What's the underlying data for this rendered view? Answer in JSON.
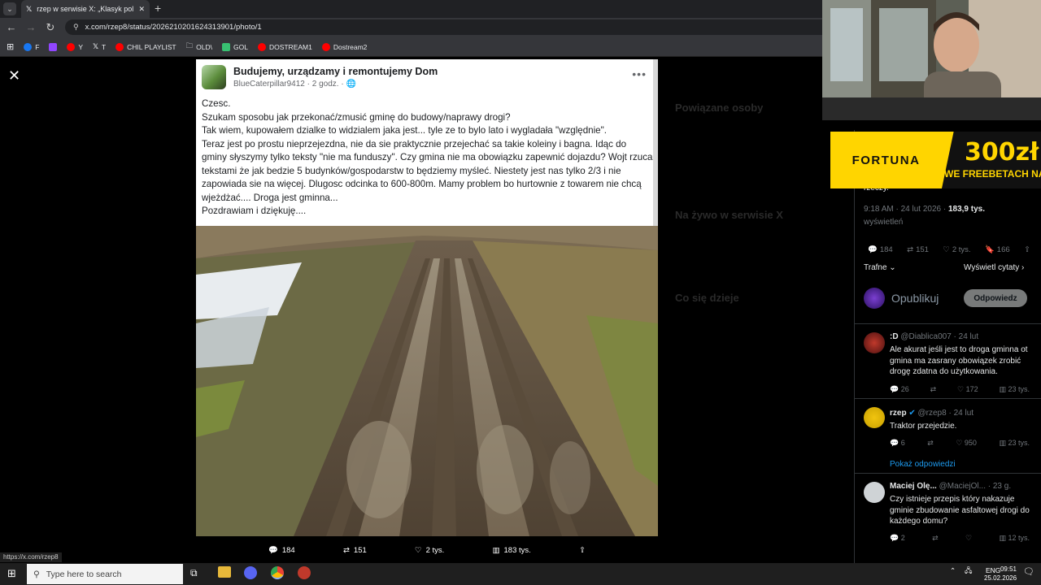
{
  "browser": {
    "tab_title": "rzep w serwisie X: „Klasyk polsk",
    "url": "x.com/rzep8/status/2026210201624313901/photo/1",
    "status_url": "https://x.com/rzep8",
    "bookmarks": [
      {
        "label": "F",
        "color": "#1877f2"
      },
      {
        "label": "",
        "color": "#9146ff"
      },
      {
        "label": "Y",
        "color": "#ff0000"
      },
      {
        "label": "T",
        "color": "#000000"
      },
      {
        "label": "CHIL PLAYLIST",
        "color": "#ff0000"
      },
      {
        "label": "OLD\\",
        "color": "folder"
      },
      {
        "label": "GOL",
        "color": "#38c172"
      },
      {
        "label": "DOSTREAM1",
        "color": "#ff0000"
      },
      {
        "label": "Dostream2",
        "color": "#ff0000"
      }
    ]
  },
  "fb_post": {
    "group": "Budujemy, urządzamy i remontujemy Dom",
    "author": "BlueCaterpillar9412",
    "time": "2 godz.",
    "lines": [
      "Czesc.",
      "Szukam sposobu jak przekonać/zmusić gminę do budowy/naprawy drogi?",
      "Tak wiem, kupowałem dzialke to widzialem jaka jest... tyle ze to bylo lato i wygladała \"względnie\".",
      "Teraz jest po prostu nieprzejezdna, nie da sie praktycznie przejechać sa takie koleiny i bagna. Idąc do gminy słyszymy tylko teksty \"nie ma funduszy\". Czy gmina nie ma obowiązku zapewnić dojazdu? Wojt rzuca tekstami że jak bedzie 5 budynków/gospodarstw to będziemy myśleć. Niestety jest nas tylko 2/3 i nie zapowiada sie na więcej. Dlugosc odcinka to 600-800m. Mamy problem bo hurtownie z towarem nie chcą wjeżdżać.... Droga jest gminna...",
      "Pozdrawiam i dziękuję...."
    ]
  },
  "photo_actions": {
    "replies": "184",
    "reposts": "151",
    "likes": "2 tys.",
    "views": "183 tys."
  },
  "tweet": {
    "timestamp": "9:18 AM · 24 lut 2026 · ",
    "views_count": "183,9 tys.",
    "views_label": "wyświetleń",
    "replies": "184",
    "reposts": "151",
    "likes": "2 tys.",
    "bookmarks": "166",
    "sort": "Trafne",
    "quotes_link": "Wyświetl cytaty",
    "compose_placeholder": "Opublikuj",
    "reply_button": "Odpowiedz",
    "truncated_text": "rzeczy."
  },
  "sidebar_dimmed": {
    "related": "Powiązane osoby",
    "live": "Na żywo w serwisie X",
    "trends": "Co się dzieje"
  },
  "ad": {
    "brand": "FORTUNA",
    "amount": "300zł",
    "subtitle": "WE FREEBETACH NA STAR"
  },
  "replies": [
    {
      "name": ":D",
      "handle": "@Diablica007 · 24 lut",
      "text": "Ale akurat jeśli jest to droga gminna ot gmina ma zasrany obowiązek zrobić drogę zdatna do użytkowania.",
      "replies": "26",
      "likes": "172",
      "views": "23 tys."
    },
    {
      "name": "rzep",
      "handle": "@rzep8 · 24 lut",
      "text": "Traktor przejedzie.",
      "replies": "6",
      "likes": "950",
      "views": "23 tys.",
      "show_replies": "Pokaż odpowiedzi"
    },
    {
      "name": "Maciej Olę...",
      "handle": "@MaciejOl... · 23 g.",
      "text": "Czy istnieje przepis który nakazuje gminie zbudowanie asfaltowej drogi do każdego domu?",
      "replies": "2",
      "likes": "",
      "views": "12 tys."
    }
  ],
  "taskbar": {
    "search_placeholder": "Type here to search",
    "lang": "ENG",
    "time": "09:51",
    "date": "25.02.2026"
  }
}
